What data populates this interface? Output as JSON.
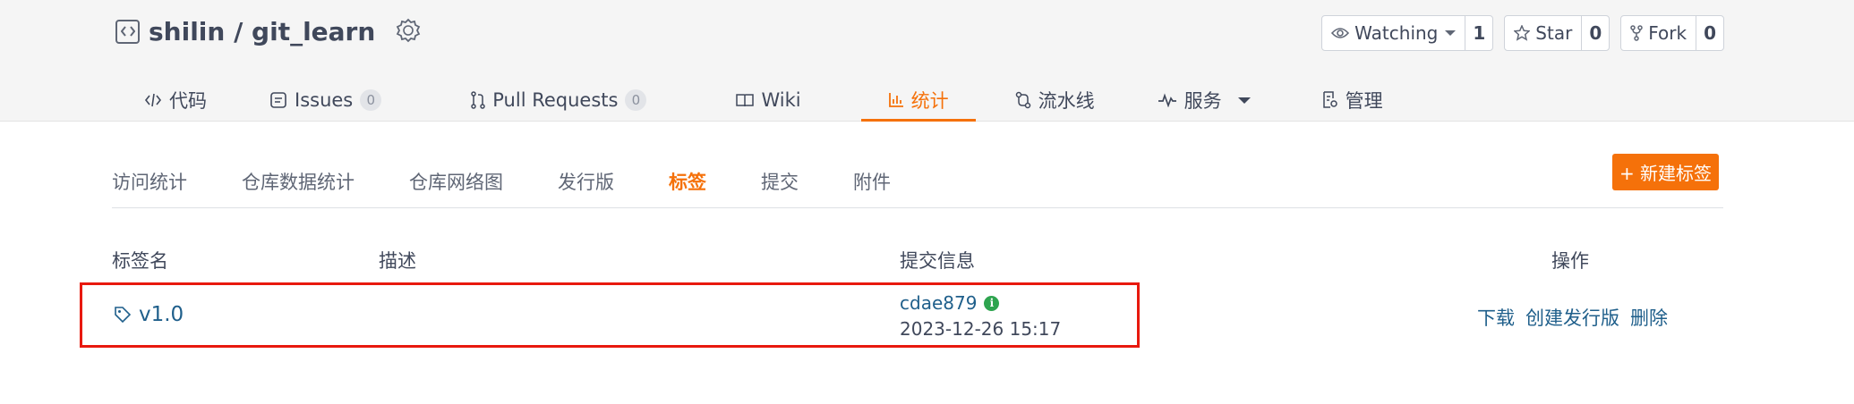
{
  "repo": {
    "title": "shilin / git_learn",
    "watching_label": "Watching",
    "watching_count": "1",
    "star_label": "Star",
    "star_count": "0",
    "fork_label": "Fork",
    "fork_count": "0"
  },
  "main_tabs": [
    {
      "label": "代码",
      "icon": "code-icon"
    },
    {
      "label": "Issues",
      "count": "0",
      "icon": "issues-icon"
    },
    {
      "label": "Pull Requests",
      "count": "0",
      "icon": "pull-request-icon"
    },
    {
      "label": "Wiki",
      "icon": "wiki-icon"
    },
    {
      "label": "统计",
      "icon": "chart-icon",
      "active": true
    },
    {
      "label": "流水线",
      "icon": "pipeline-icon"
    },
    {
      "label": "服务",
      "icon": "pulse-icon"
    },
    {
      "label": "管理",
      "icon": "settings-doc-icon"
    }
  ],
  "sub_tabs": [
    "访问统计",
    "仓库数据统计",
    "仓库网络图",
    "发行版",
    "标签",
    "提交",
    "附件"
  ],
  "sub_tab_active": "标签",
  "new_tag_button": "+ 新建标签",
  "table": {
    "headers": {
      "name": "标签名",
      "desc": "描述",
      "commit": "提交信息",
      "ops": "操作"
    },
    "rows": [
      {
        "name": "v1.0",
        "description": "",
        "commit_sha": "cdae879",
        "commit_date": "2023-12-26 15:17",
        "ops": [
          "下载",
          "创建发行版",
          "删除"
        ]
      }
    ]
  },
  "colors": {
    "accent": "#f5710a",
    "link": "#1f5f8b",
    "highlight": "#e8190e"
  }
}
